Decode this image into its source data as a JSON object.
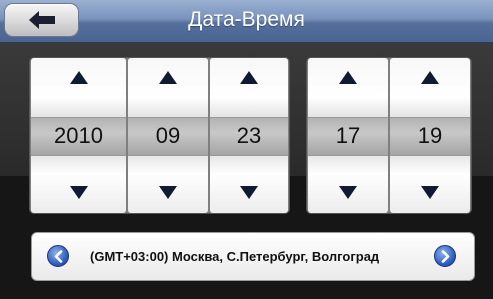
{
  "header": {
    "title": "Дата-Время",
    "back_icon": "arrow-left-icon",
    "accent": "#7993bd"
  },
  "date": {
    "year": "2010",
    "month": "09",
    "day": "23"
  },
  "time": {
    "hour": "17",
    "minute": "19"
  },
  "timezone": {
    "label": "(GMT+03:00) Москва, С.Петербург, Волгоград",
    "prev_icon": "chevron-left-circle-icon",
    "next_icon": "chevron-right-circle-icon"
  }
}
